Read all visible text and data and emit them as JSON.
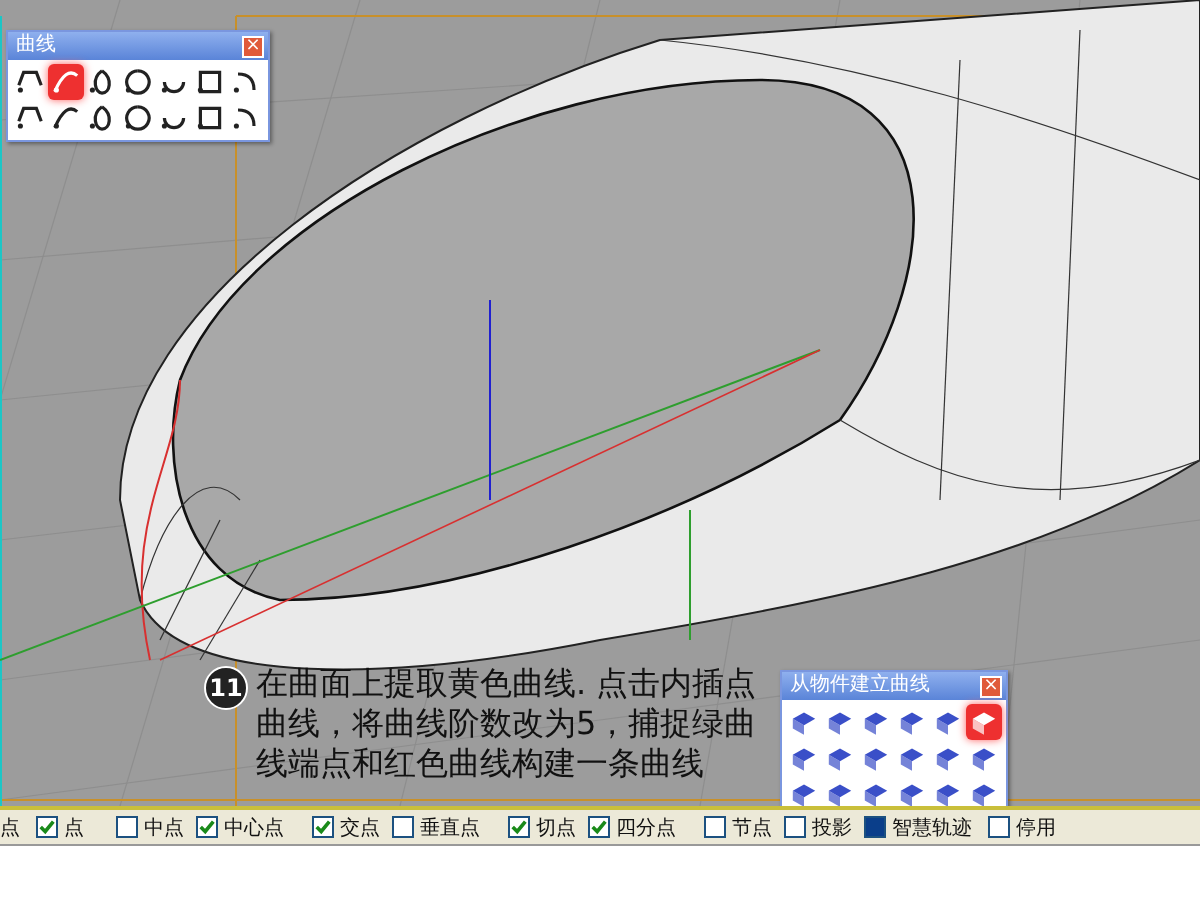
{
  "palettes": [
    {
      "kind": "curve",
      "title": "曲线",
      "close": "×",
      "tools": [
        {
          "selected": false
        },
        {
          "selected": true
        },
        {
          "selected": false
        },
        {
          "selected": false
        },
        {
          "selected": false
        },
        {
          "selected": false
        },
        {
          "selected": false
        },
        {
          "selected": false
        },
        {
          "selected": false
        },
        {
          "selected": false
        },
        {
          "selected": false
        },
        {
          "selected": false
        },
        {
          "selected": false
        },
        {
          "selected": false
        }
      ]
    },
    {
      "kind": "surface",
      "title": "从物件建立曲线",
      "close": "×",
      "tools": [
        {
          "selected": false
        },
        {
          "selected": false
        },
        {
          "selected": false
        },
        {
          "selected": false
        },
        {
          "selected": false
        },
        {
          "selected": true
        },
        {
          "selected": false
        },
        {
          "selected": false
        },
        {
          "selected": false
        },
        {
          "selected": false
        },
        {
          "selected": false
        },
        {
          "selected": false
        },
        {
          "selected": false
        },
        {
          "selected": false
        },
        {
          "selected": false
        },
        {
          "selected": false
        },
        {
          "selected": false
        },
        {
          "selected": false
        }
      ]
    }
  ],
  "step": {
    "number": "11",
    "text": "在曲面上提取黄色曲线. 点击内插点曲线，将曲线阶数改为5，捕捉绿曲线端点和红色曲线构建一条曲线"
  },
  "osnap": [
    {
      "label": "点",
      "kind": "cut"
    },
    {
      "label": "点",
      "kind": "check",
      "checked": true
    },
    {
      "label": "中点",
      "kind": "check",
      "checked": false
    },
    {
      "label": "中心点",
      "kind": "check",
      "checked": true
    },
    {
      "label": "交点",
      "kind": "check",
      "checked": true
    },
    {
      "label": "垂直点",
      "kind": "check",
      "checked": false
    },
    {
      "label": "切点",
      "kind": "check",
      "checked": true
    },
    {
      "label": "四分点",
      "kind": "check",
      "checked": true
    },
    {
      "label": "节点",
      "kind": "check",
      "checked": false
    },
    {
      "label": "投影",
      "kind": "check",
      "checked": false
    },
    {
      "label": "智慧轨迹",
      "kind": "toggle",
      "checked": true
    },
    {
      "label": "停用",
      "kind": "check",
      "checked": false
    }
  ]
}
